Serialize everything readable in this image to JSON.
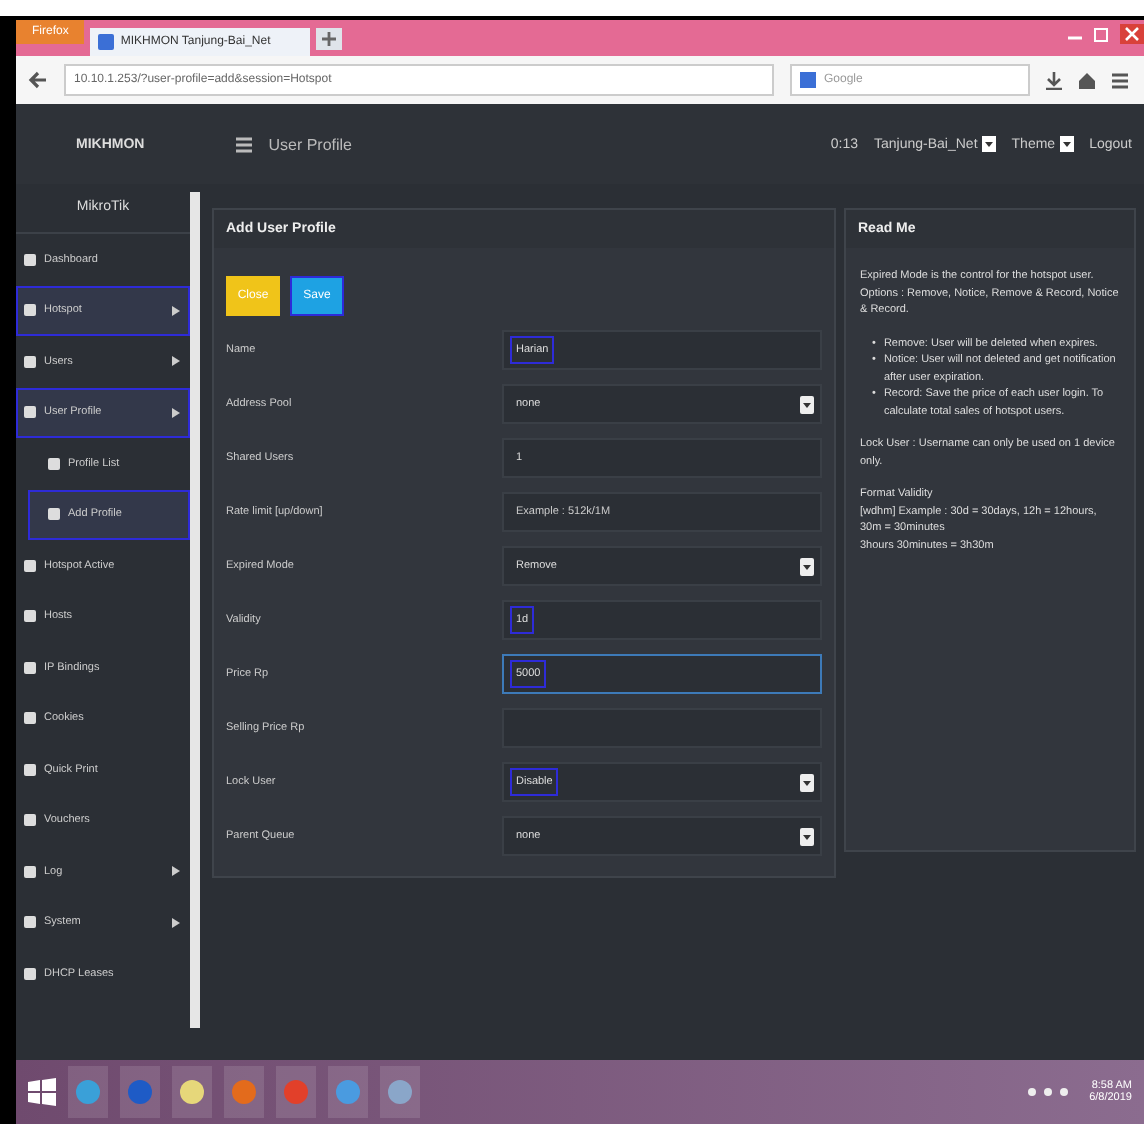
{
  "browser": {
    "menu_button": "Firefox",
    "tab_title": "MIKHMON Tanjung-Bai_Net",
    "url": "10.10.1.253/?user-profile=add&session=Hotspot",
    "search_placeholder": "Google"
  },
  "header": {
    "brand": "MIKHMON",
    "page_title": "User Profile",
    "clock": "0:13",
    "session": "Tanjung-Bai_Net",
    "theme": "Theme",
    "logout": "Logout"
  },
  "sidebar": {
    "title": "MikroTik",
    "items": [
      {
        "label": "Dashboard",
        "highlighted": false,
        "expandable": false
      },
      {
        "label": "Hotspot",
        "highlighted": true,
        "expandable": true
      },
      {
        "label": "Users",
        "highlighted": false,
        "expandable": true
      },
      {
        "label": "User Profile",
        "highlighted": true,
        "expandable": true,
        "children": [
          {
            "label": "Profile List",
            "highlighted": false
          },
          {
            "label": "Add Profile",
            "highlighted": true
          }
        ]
      },
      {
        "label": "Hotspot Active",
        "highlighted": false,
        "expandable": false
      },
      {
        "label": "Hosts",
        "highlighted": false,
        "expandable": false
      },
      {
        "label": "IP Bindings",
        "highlighted": false,
        "expandable": false
      },
      {
        "label": "Cookies",
        "highlighted": false,
        "expandable": false
      },
      {
        "label": "Quick Print",
        "highlighted": false,
        "expandable": false
      },
      {
        "label": "Vouchers",
        "highlighted": false,
        "expandable": false
      },
      {
        "label": "Log",
        "highlighted": false,
        "expandable": true
      },
      {
        "label": "System",
        "highlighted": false,
        "expandable": true
      },
      {
        "label": "DHCP Leases",
        "highlighted": false,
        "expandable": false
      }
    ]
  },
  "form": {
    "title": "Add User Profile",
    "buttons": [
      {
        "label": "Close",
        "kind": "close"
      },
      {
        "label": "Save",
        "kind": "save"
      }
    ],
    "fields": [
      {
        "label": "Name",
        "kind": "text",
        "value": "Harian",
        "highlighted": true,
        "focused": false
      },
      {
        "label": "Address Pool",
        "kind": "select",
        "value": "none",
        "highlighted": false,
        "focused": false
      },
      {
        "label": "Shared Users",
        "kind": "text",
        "value": "1",
        "highlighted": false,
        "focused": false
      },
      {
        "label": "Rate limit [up/down]",
        "kind": "text",
        "placeholder": "Example : 512k/1M",
        "highlighted": false,
        "focused": false
      },
      {
        "label": "Expired Mode",
        "kind": "select",
        "value": "Remove",
        "highlighted": false,
        "focused": false
      },
      {
        "label": "Validity",
        "kind": "text",
        "value": "1d",
        "highlighted": true,
        "focused": false
      },
      {
        "label": "Price Rp",
        "kind": "text",
        "value": "5000",
        "highlighted": true,
        "focused": true
      },
      {
        "label": "Selling Price Rp",
        "kind": "text",
        "focused": false
      },
      {
        "label": "Lock User",
        "kind": "select",
        "value": "Disable",
        "highlighted": true,
        "focused": false
      },
      {
        "label": "Parent Queue",
        "kind": "select",
        "value": "none",
        "highlighted": false,
        "focused": false
      }
    ]
  },
  "readme": {
    "title": "Read Me",
    "intro": "Expired Mode is the control for the hotspot user. Options : Remove, Notice, Remove & Record, Notice & Record.",
    "bullets": [
      {
        "marker": "•",
        "text": "Remove: User will be deleted when expires."
      },
      {
        "marker": "•",
        "text": "Notice: User will not deleted and get notification after user expiration."
      },
      {
        "marker": "•",
        "text": "Record: Save the price of each user login. To calculate total sales of hotspot users."
      }
    ],
    "lock_note": "Lock User : Username can only be used on 1 device only.",
    "validity_lines": [
      "Format Validity",
      "[wdhm] Example : 30d = 30days, 12h = 12hours, 30m = 30minutes",
      "3hours 30minutes = 3h30m"
    ]
  },
  "taskbar": {
    "time": "8:58 AM",
    "date": "6/8/2019"
  }
}
